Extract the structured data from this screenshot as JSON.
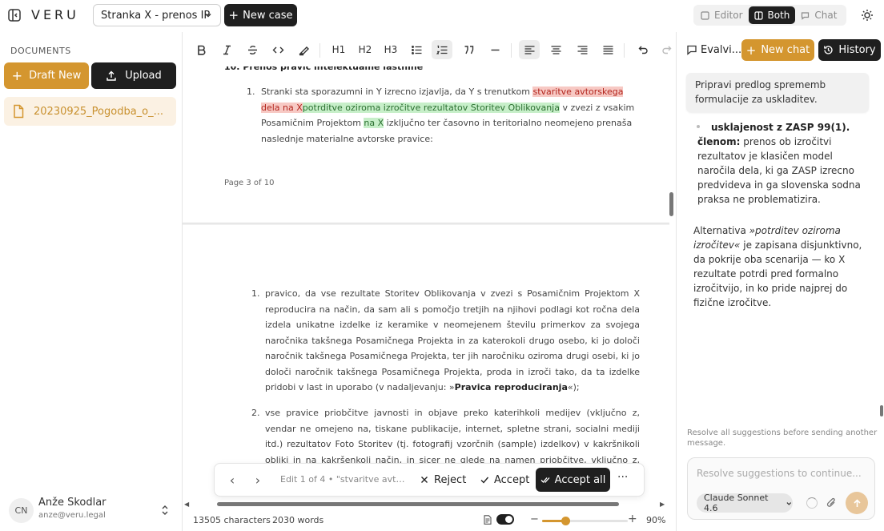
{
  "header": {
    "brand": "VERU",
    "case_name": "Stranka X - prenos IP",
    "new_case_label": "New case",
    "view_modes": [
      {
        "label": "Editor",
        "active": false
      },
      {
        "label": "Both",
        "active": true
      },
      {
        "label": "Chat",
        "active": false
      }
    ]
  },
  "sidebar": {
    "section_label": "DOCUMENTS",
    "draft_new_label": "Draft New",
    "upload_label": "Upload",
    "documents": [
      {
        "name": "20230925_Pogodba_o_..."
      }
    ],
    "user": {
      "initials": "CN",
      "name": "Anže Skodlar",
      "email": "anze@veru.legal"
    }
  },
  "editor": {
    "toolbar": {
      "h1": "H1",
      "h2": "H2",
      "h3": "H3"
    },
    "doc": {
      "section_title": "10.   Prenos pravic intelektualne lastnine",
      "p1_num": "1.",
      "p1_text_a": "Stranki sta sporazumni in Y izrecno izjavlja, da Y s trenutkom ",
      "p1_deleted": "stvaritve avtorskega dela na X",
      "p1_inserted": "potrditve oziroma izročitve rezultatov Storitev Oblikovanja",
      "p1_text_b": " v zvezi z vsakim Posamičnim Projektom ",
      "p1_inserted2": "na X",
      "p1_text_c": " izključno ter časovno in teritorialno neomejeno prenaša naslednje materialne avtorske pravice:",
      "page_number": "Page 3 of 10",
      "item1_num": "1.",
      "item1_text": "pravico, da vse rezultate Storitev Oblikovanja v zvezi s Posamičnim Projektom X reproducira na način, da sam ali s pomočjo tretjih na njihovi podlagi kot ročna dela izdela unikatne izdelke iz keramike v neomejenem številu primerkov za svojega naročnika takšnega Posamičnega Projekta in za katerokoli drugo osebo, ki jo določi naročnik takšnega Posamičnega Projekta, ter jih naročniku oziroma drugi osebi, ki jo določi naročnik takšnega Posamičnega Projekta, proda in izroči tako, da ta izdelke pridobi v last in uporabo (v nadaljevanju: »",
      "item1_bold": "Pravica reproduciranja",
      "item1_end": "«);",
      "item2_num": "2.",
      "item2_text": "vse pravice priobčitve javnosti in objave preko katerihkoli medijev (vključno z, vendar ne omejeno na, tiskane publikacije, internet, spletne strani, socialni mediji itd.) rezultatov Foto Storitev (tj. fotografij vzorčnih (sample) izdelkov) v kakršnikoli obliki in na kakršenkoli način, in sicer ne glede na namen priobčitve, vključno z, vendar ne omejeno"
    },
    "suggestion_bar": {
      "info": "Edit 1 of 4 • \"stvaritve avtorske...",
      "reject_label": "Reject",
      "accept_label": "Accept",
      "accept_all_label": "Accept all",
      "more_label": "···"
    },
    "status": {
      "characters": "13505 characters",
      "words": "2030 words",
      "zoom": "90%",
      "zoom_level": 0.27
    }
  },
  "chat": {
    "tab_label": "Evalvi...",
    "new_chat_label": "New chat",
    "history_label": "History",
    "user_message": "Pripravi predlog sprememb formulacije za uskladitev.",
    "assistant_bullet_head": "usklajenost z ZASP 99(1).",
    "assistant_bullet_bold": "členom:",
    "assistant_bullet_text": " prenos ob izročitvi rezultatov je klasičen model naročila dela, ki ga ZASP izrecno predvideva in ga slovenska sodna praksa ne problematizira.",
    "assistant_p2_a": "Alternativa ",
    "assistant_p2_italic": "»potrditev oziroma izročitev«",
    "assistant_p2_b": " je zapisana disjunktivno, da pokrije oba scenarija — ko X rezultate potrdi pred formalno izročitvijo, in ko pride najprej do fizične izročitve.",
    "resolve_note": "Resolve all suggestions before sending another message.",
    "composer_placeholder": "Resolve suggestions to continue...",
    "model_label": "Claude Sonnet 4.6"
  },
  "colors": {
    "accent": "#d4962f",
    "dark": "#1f1f1f",
    "deleted_bg": "#f7c9c4",
    "inserted_bg": "#c7efc9"
  }
}
